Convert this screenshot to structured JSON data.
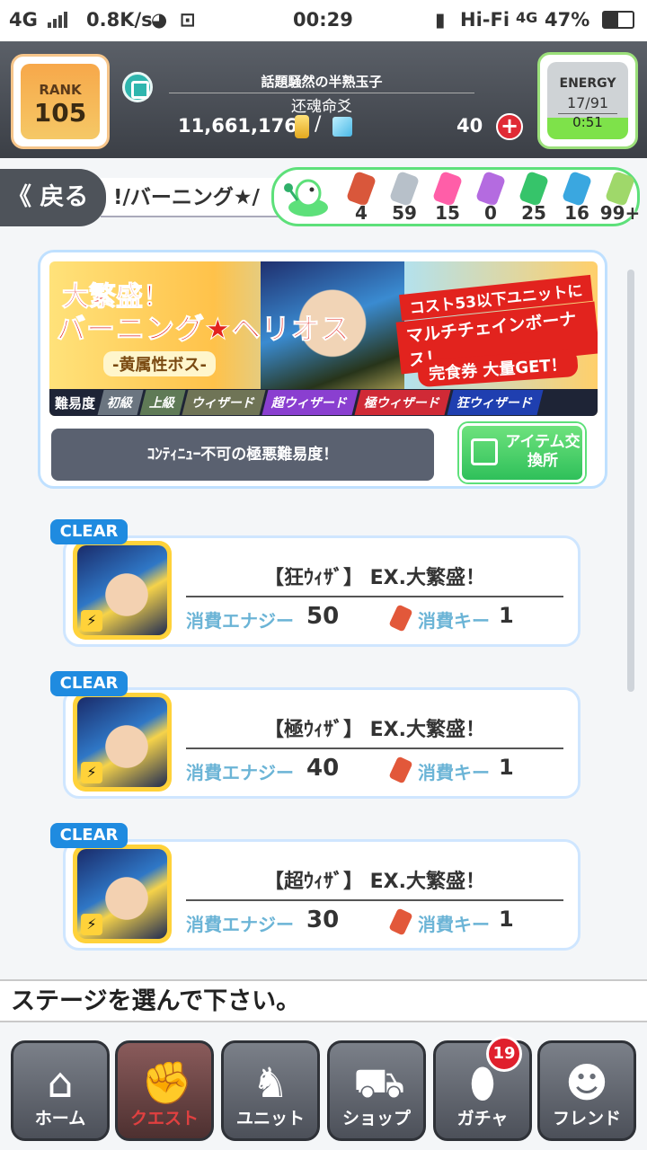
{
  "status_bar": {
    "network": "4G",
    "speed": "0.8K/s",
    "time": "00:29",
    "wifi": "Hi-Fi",
    "network2": "4G",
    "battery": "47%"
  },
  "header": {
    "rank_label": "RANK",
    "rank_value": "105",
    "title": "話題騒然の半熟玉子",
    "name": "还魂命爻",
    "gold": "11,661,176",
    "slash": "/",
    "gems": "40",
    "energy_label": "ENERGY",
    "energy_value": "17/91",
    "energy_timer": "0:51"
  },
  "nav_row": {
    "back_label": "《 戻る",
    "stage_title_fragment": "!/バーニング★/"
  },
  "keys": [
    {
      "icon": "red-key-icon",
      "count": "4",
      "color": "#d9573b"
    },
    {
      "icon": "silver-key-icon",
      "count": "59",
      "color": "#b7c0c9"
    },
    {
      "icon": "pink-star-key-icon",
      "count": "15",
      "color": "#ff5ea8"
    },
    {
      "icon": "purple-key-icon",
      "count": "0",
      "color": "#b46be0"
    },
    {
      "icon": "green-key-icon",
      "count": "25",
      "color": "#36c46a"
    },
    {
      "icon": "blue-key-icon",
      "count": "16",
      "color": "#3aa7e0"
    },
    {
      "icon": "rainbow-key-icon",
      "count": "99+",
      "color": "#9fd86a"
    }
  ],
  "event": {
    "banner_line1": "大繁盛！",
    "banner_line2": "バーニング★ヘリオス",
    "banner_boss": "-黄属性ボス-",
    "bonus_line1": "コスト53以下ユニットに",
    "bonus_line2": "マルチチェインボーナス！",
    "ticket": "完食券 大量GET！",
    "difficulty_label": "難易度",
    "difficulties": [
      {
        "label": "初級",
        "color": "#6b7580"
      },
      {
        "label": "上級",
        "color": "#5f7a56"
      },
      {
        "label": "ウィザード",
        "color": "#6f7456"
      },
      {
        "label": "超ウィザード",
        "color": "#8a3fd0"
      },
      {
        "label": "極ウィザード",
        "color": "#d02a36"
      },
      {
        "label": "狂ウィザード",
        "color": "#1f3fb0"
      }
    ],
    "info_text": "ｺﾝﾃｨﾆｭｰ不可の極悪難易度！",
    "exchange_label": "アイテム交換所"
  },
  "stages": [
    {
      "badge": "CLEAR",
      "name": "【狂ｳｨｻﾞ】 EX.大繁盛！",
      "energy_label": "消費エナジー",
      "energy": "50",
      "key_label": "消費キー",
      "key": "1"
    },
    {
      "badge": "CLEAR",
      "name": "【極ｳｨｻﾞ】 EX.大繁盛！",
      "energy_label": "消費エナジー",
      "energy": "40",
      "key_label": "消費キー",
      "key": "1"
    },
    {
      "badge": "CLEAR",
      "name": "【超ｳｨｻﾞ】 EX.大繁盛！",
      "energy_label": "消費エナジー",
      "energy": "30",
      "key_label": "消費キー",
      "key": "1"
    }
  ],
  "instruction": "ステージを選んで下さい。",
  "bottom_nav": [
    {
      "label": "ホーム",
      "icon": "home-icon",
      "glyph": "⌂"
    },
    {
      "label": "クエスト",
      "icon": "quest-handshake-icon",
      "glyph": "✊"
    },
    {
      "label": "ユニット",
      "icon": "unit-rabbit-icon",
      "glyph": "♞"
    },
    {
      "label": "ショップ",
      "icon": "shop-cart-icon",
      "glyph": "⛟"
    },
    {
      "label": "ガチャ",
      "icon": "gacha-egg-icon",
      "glyph": "⬮",
      "badge": "19"
    },
    {
      "label": "フレンド",
      "icon": "friend-icon",
      "glyph": "☻"
    }
  ]
}
